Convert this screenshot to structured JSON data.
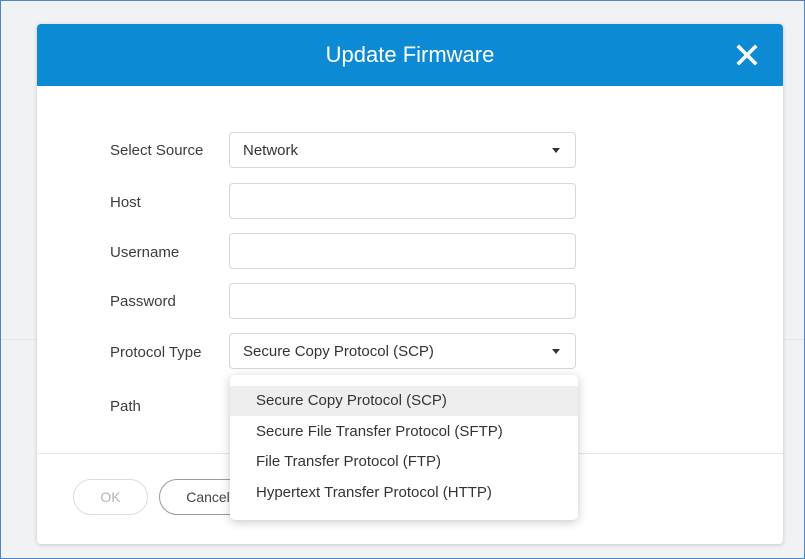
{
  "dialog": {
    "title": "Update Firmware",
    "close_icon": "close-icon",
    "header_color": "#0c8bd4"
  },
  "form": {
    "source": {
      "label": "Select Source",
      "value": "Network"
    },
    "host": {
      "label": "Host",
      "value": ""
    },
    "username": {
      "label": "Username",
      "value": ""
    },
    "password": {
      "label": "Password",
      "value": ""
    },
    "protocol": {
      "label": "Protocol Type",
      "value": "Secure Copy Protocol (SCP)"
    },
    "path": {
      "label": "Path"
    }
  },
  "dropdown": {
    "options": [
      "Secure Copy Protocol (SCP)",
      "Secure File Transfer Protocol (SFTP)",
      "File Transfer Protocol (FTP)",
      "Hypertext Transfer Protocol (HTTP)"
    ],
    "selected_index": 0
  },
  "footer": {
    "ok_label": "OK",
    "cancel_label": "Cancel"
  }
}
